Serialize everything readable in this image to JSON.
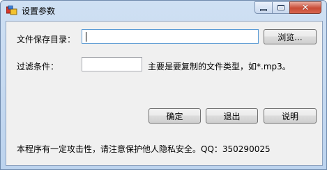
{
  "window": {
    "title": "设置参数",
    "close_glyph": "✕"
  },
  "form": {
    "dir_label": "文件保存目录：",
    "dir_value": "",
    "browse_label": "浏览...",
    "filter_label": "过滤条件：",
    "filter_value": "",
    "filter_hint": "主要是要复制的文件类型，如*.mp3。"
  },
  "actions": {
    "ok_label": "确定",
    "exit_label": "退出",
    "help_label": "说明"
  },
  "footer": {
    "notice": "本程序有一定攻击性，请注意保护他人隐私安全。QQ：350290025"
  },
  "icons": {
    "app": "app-icon",
    "minimize": "minimize-icon",
    "maximize": "maximize-icon",
    "close": "close-icon"
  },
  "colors": {
    "titlebar": "#c4d8f0",
    "client_bg": "#f0f0f0",
    "close_button": "#c84b35",
    "focus_border": "#5b9bd5"
  }
}
